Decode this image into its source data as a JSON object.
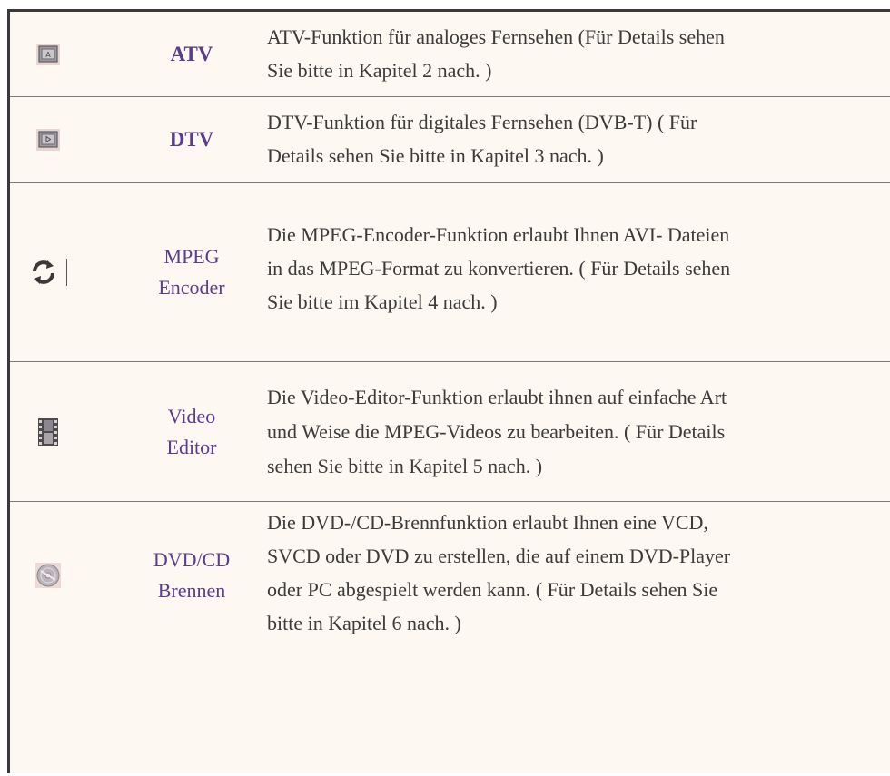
{
  "rows": [
    {
      "label_line1": "ATV",
      "label_line2": "",
      "icon": "atv-tv-icon",
      "desc_line1": "ATV-Funktion für analoges Fernsehen (Für Details sehen",
      "desc_line2": "Sie bitte in Kapitel 2 nach. )",
      "desc_line3": "",
      "desc_line4": ""
    },
    {
      "label_line1": "DTV",
      "label_line2": "",
      "icon": "dtv-tv-icon",
      "desc_line1": "DTV-Funktion für digitales  Fernsehen (DVB-T) ( Für",
      "desc_line2": "Details sehen Sie bitte in Kapitel 3 nach. )",
      "desc_line3": "",
      "desc_line4": ""
    },
    {
      "label_line1": "MPEG",
      "label_line2": "Encoder",
      "icon": "convert-arrows-icon",
      "desc_line1": "Die MPEG-Encoder-Funktion erlaubt Ihnen AVI- Dateien",
      "desc_line2": "in das MPEG-Format zu konvertieren. ( Für Details sehen",
      "desc_line3": "Sie bitte im Kapitel 4 nach. )",
      "desc_line4": ""
    },
    {
      "label_line1": "Video",
      "label_line2": "Editor",
      "icon": "film-strip-icon",
      "desc_line1": "Die Video-Editor-Funktion erlaubt ihnen auf einfache Art",
      "desc_line2": "und Weise die MPEG-Videos zu bearbeiten. ( Für Details",
      "desc_line3": "sehen Sie bitte in Kapitel 5 nach. )",
      "desc_line4": ""
    },
    {
      "label_line1": "DVD/CD",
      "label_line2": "Brennen",
      "icon": "disc-icon",
      "desc_line1": "Die DVD-/CD-Brennfunktion erlaubt Ihnen eine VCD,",
      "desc_line2": "SVCD oder DVD zu erstellen, die auf einem DVD-Player",
      "desc_line3": "oder PC abgespielt werden kann. ( Für Details sehen Sie",
      "desc_line4": "bitte in Kapitel 6 nach. )"
    }
  ]
}
